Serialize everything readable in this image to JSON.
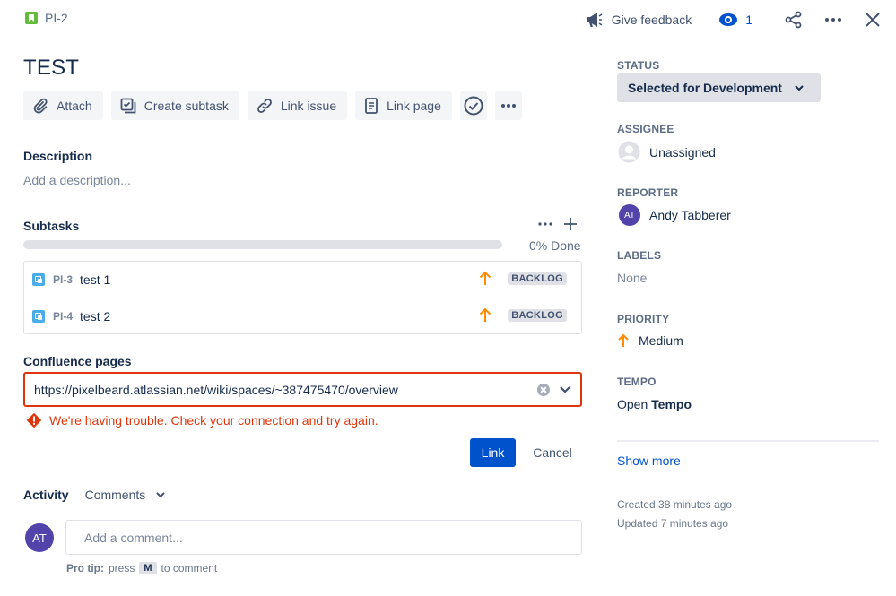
{
  "header": {
    "issue_key": "PI-2",
    "feedback_label": "Give feedback",
    "watch_count": "1"
  },
  "issue": {
    "title": "TEST"
  },
  "toolbar": {
    "attach_label": "Attach",
    "create_subtask_label": "Create subtask",
    "link_issue_label": "Link issue",
    "link_page_label": "Link page"
  },
  "description": {
    "heading": "Description",
    "placeholder": "Add a description..."
  },
  "subtasks": {
    "heading": "Subtasks",
    "progress_text": "0% Done",
    "progress_fraction": 0,
    "rows": [
      {
        "key": "PI-3",
        "summary": "test 1",
        "status": "BACKLOG"
      },
      {
        "key": "PI-4",
        "summary": "test 2",
        "status": "BACKLOG"
      }
    ]
  },
  "confluence": {
    "heading": "Confluence pages",
    "url_value": "https://pixelbeard.atlassian.net/wiki/spaces/~387475470/overview",
    "error_message": "We're having trouble. Check your connection and try again.",
    "link_label": "Link",
    "cancel_label": "Cancel"
  },
  "activity": {
    "heading": "Activity",
    "filter_label": "Comments",
    "avatar_initials": "AT",
    "comment_placeholder": "Add a comment...",
    "protip_label": "Pro tip:",
    "protip_press": "press",
    "protip_key": "M",
    "protip_suffix": "to comment"
  },
  "sidebar": {
    "status_label": "STATUS",
    "status_value": "Selected for Development",
    "assignee_label": "ASSIGNEE",
    "assignee_value": "Unassigned",
    "reporter_label": "REPORTER",
    "reporter_initials": "AT",
    "reporter_value": "Andy Tabberer",
    "labels_label": "LABELS",
    "labels_value": "None",
    "priority_label": "PRIORITY",
    "priority_value": "Medium",
    "tempo_label": "TEMPO",
    "tempo_open": "Open",
    "tempo_name": "Tempo",
    "show_more": "Show more",
    "created": "Created 38 minutes ago",
    "updated": "Updated 7 minutes ago"
  },
  "colors": {
    "primary": "#0052cc",
    "error": "#de350b",
    "priority_medium": "#ff8b00",
    "avatar": "#5243aa",
    "story": "#63ba3c",
    "subtask": "#4bade8"
  }
}
